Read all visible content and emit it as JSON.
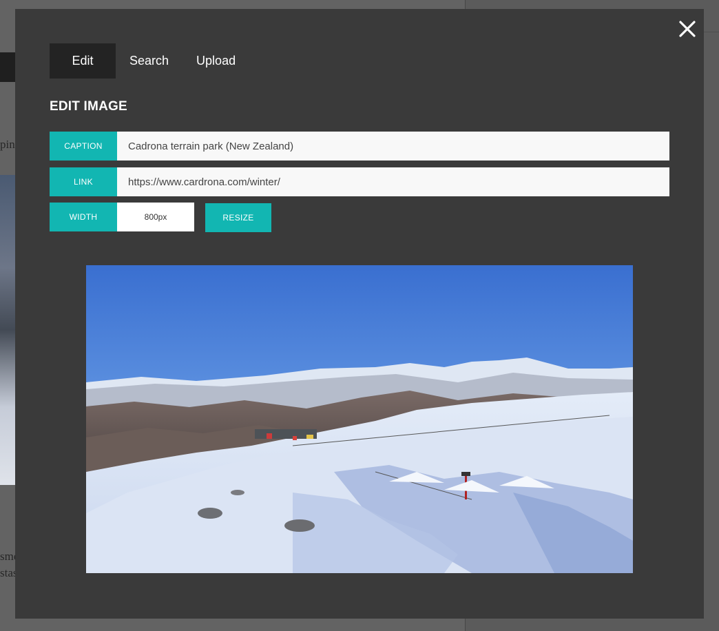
{
  "background": {
    "text_line_1": "ping",
    "text_line_2": "sme",
    "text_line_3": "stas"
  },
  "modal": {
    "tabs": [
      {
        "label": "Edit",
        "active": true
      },
      {
        "label": "Search",
        "active": false
      },
      {
        "label": "Upload",
        "active": false
      }
    ],
    "title": "EDIT IMAGE",
    "caption": {
      "label": "CAPTION",
      "value": "Cadrona terrain park (New Zealand)"
    },
    "link": {
      "label": "LINK",
      "value": "https://www.cardrona.com/winter/"
    },
    "width": {
      "label": "WIDTH",
      "value": "800px"
    },
    "resize_label": "RESIZE",
    "icons": {
      "close": "close-icon"
    }
  },
  "colors": {
    "accent": "#12b6b2",
    "modal_bg": "#3a3a3a",
    "active_tab_bg": "#232323",
    "overlay_bg": "#5b5b5b"
  }
}
